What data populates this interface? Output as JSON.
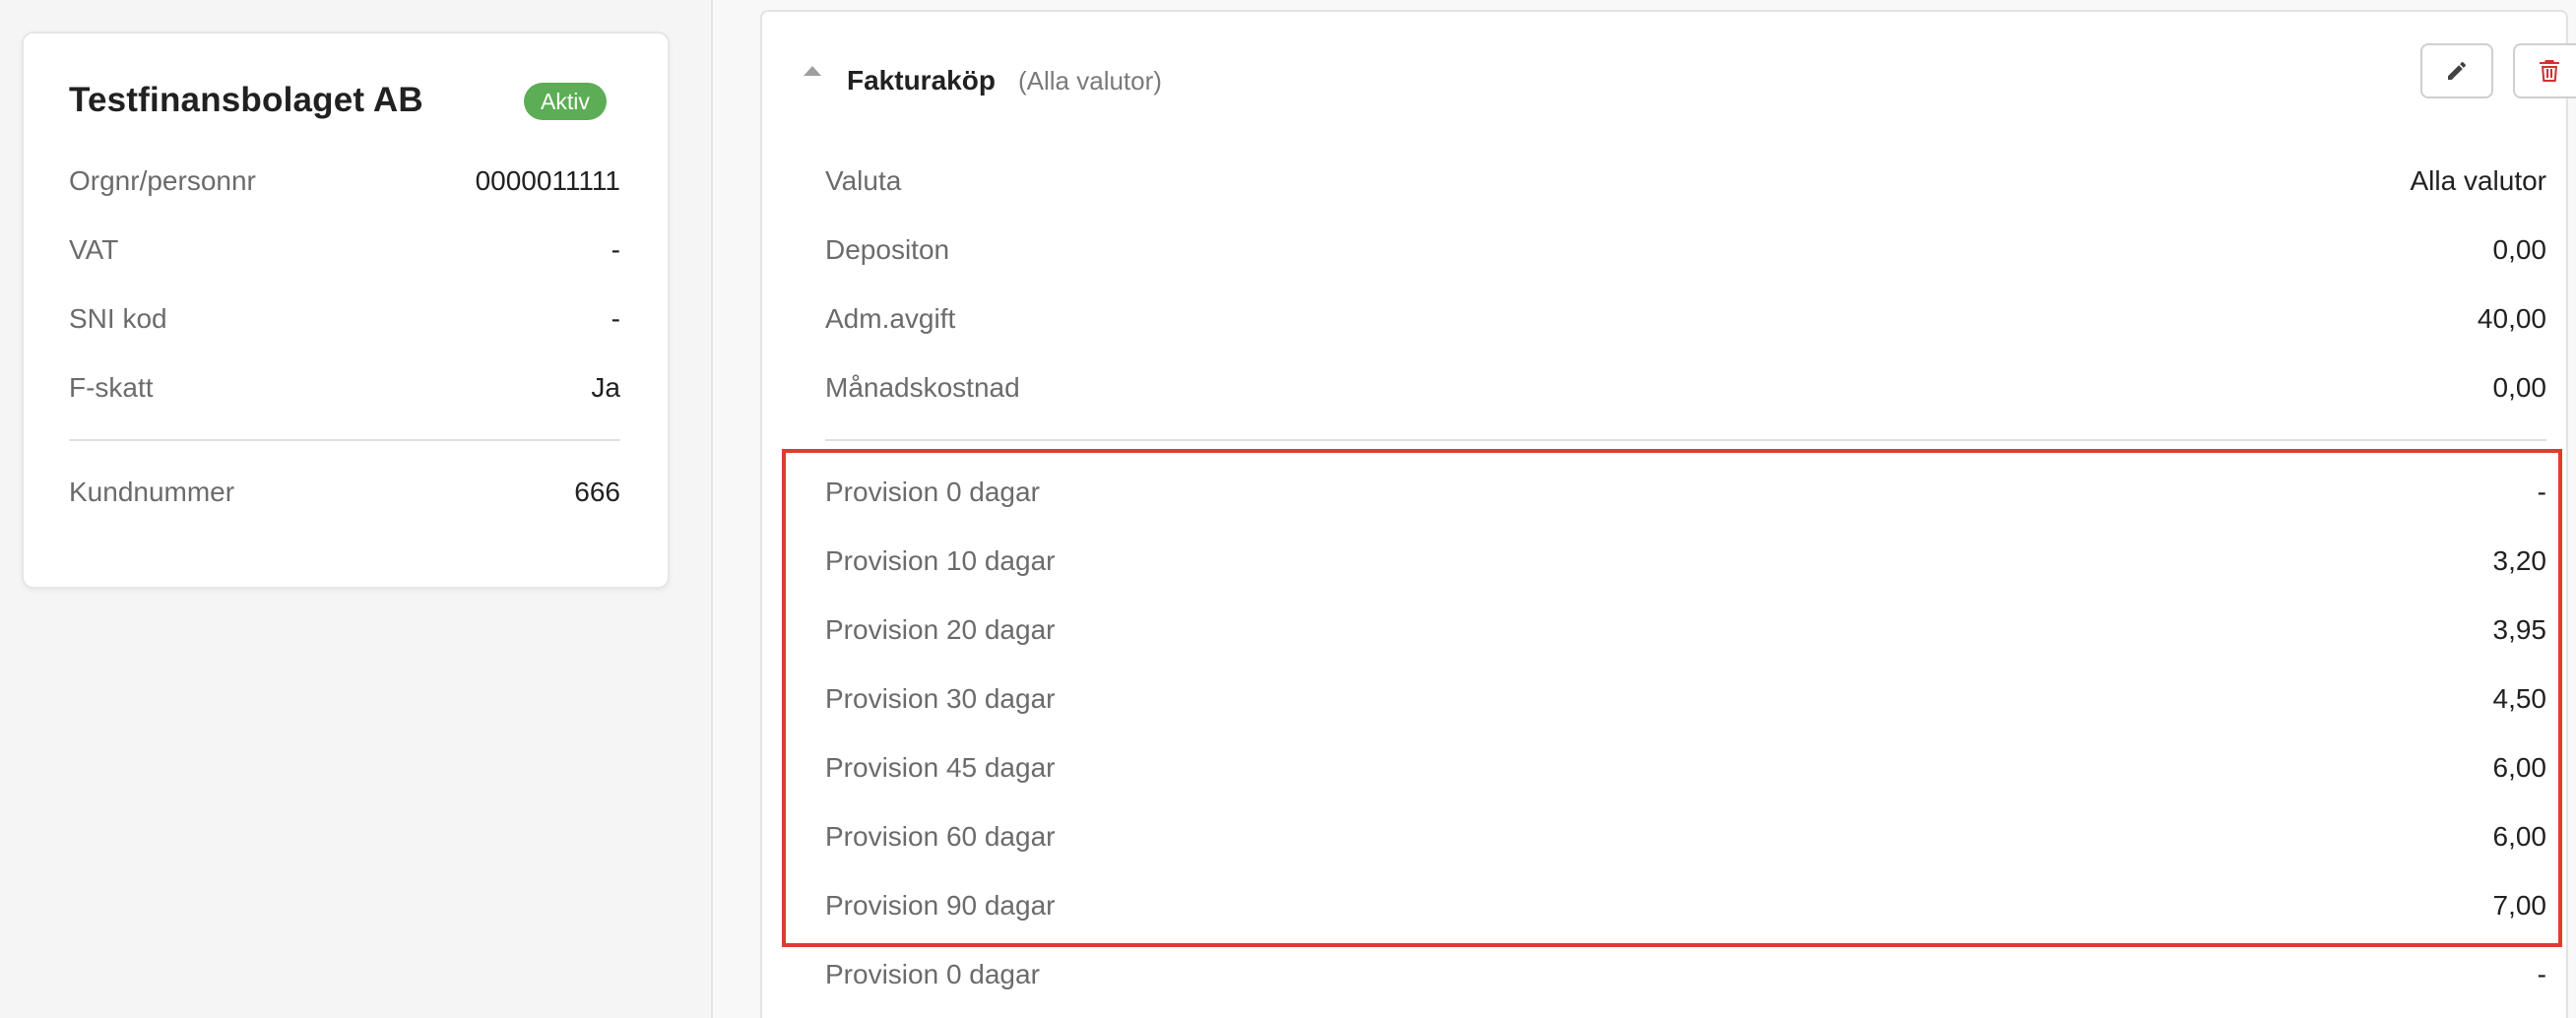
{
  "company": {
    "name": "Testfinansbolaget AB",
    "status": "Aktiv",
    "fields": [
      {
        "label": "Orgnr/personnr",
        "value": "0000011111"
      },
      {
        "label": "VAT",
        "value": "-"
      },
      {
        "label": "SNI kod",
        "value": "-"
      },
      {
        "label": "F-skatt",
        "value": "Ja"
      }
    ],
    "customer_number": {
      "label": "Kundnummer",
      "value": "666"
    }
  },
  "product": {
    "title": "Fakturaköp",
    "subtitle": "(Alla valutor)",
    "details": [
      {
        "label": "Valuta",
        "value": "Alla valutor"
      },
      {
        "label": "Depositon",
        "value": "0,00"
      },
      {
        "label": "Adm.avgift",
        "value": "40,00"
      },
      {
        "label": "Månadskostnad",
        "value": "0,00"
      }
    ],
    "provisions": [
      {
        "label": "Provision 0 dagar",
        "value": "-"
      },
      {
        "label": "Provision 10 dagar",
        "value": "3,20"
      },
      {
        "label": "Provision 20 dagar",
        "value": "3,95"
      },
      {
        "label": "Provision 30 dagar",
        "value": "4,50"
      },
      {
        "label": "Provision 45 dagar",
        "value": "6,00"
      },
      {
        "label": "Provision 60 dagar",
        "value": "6,00"
      },
      {
        "label": "Provision 90 dagar",
        "value": "7,00"
      },
      {
        "label": "Provision 0 dagar",
        "value": "-"
      }
    ]
  },
  "colors": {
    "status_badge": "#5cad55",
    "highlight": "#e03c2e",
    "delete_icon": "#d32f2f",
    "edit_icon": "#424242"
  },
  "icons": {
    "collapse": "triangle-up-icon",
    "edit": "pencil-icon",
    "delete": "trash-icon"
  }
}
